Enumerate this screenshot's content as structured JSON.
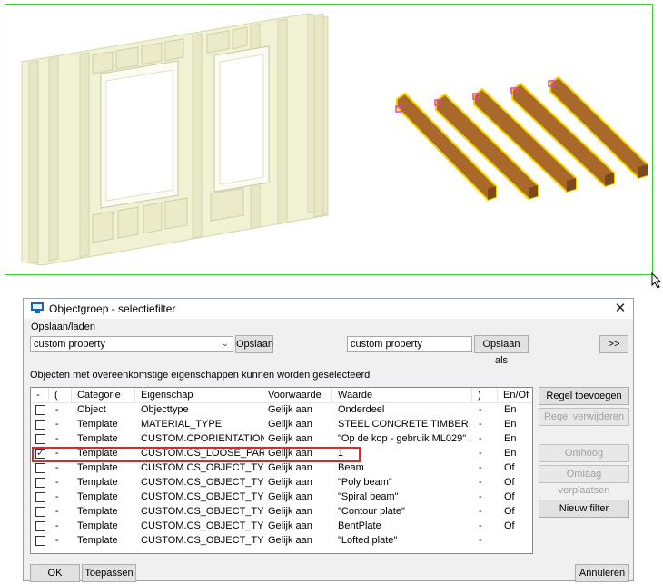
{
  "dialog": {
    "title": "Objectgroep - selectiefilter",
    "close": "✕",
    "load_save_label": "Opslaan/laden",
    "preset_value": "custom property",
    "save_button": "Opslaan",
    "save_as_field": "custom property",
    "save_as_button": "Opslaan als",
    "expand_button": ">>",
    "description": "Objecten met overeenkomstige eigenschappen kunnen worden geselecteerd",
    "columns": [
      "-",
      "(",
      "Categorie",
      "Eigenschap",
      "Voorwaarde",
      "Waarde",
      ")",
      "En/Of"
    ],
    "rows": [
      {
        "checked": false,
        "open": "-",
        "category": "Object",
        "property": "Objecttype",
        "condition": "Gelijk aan",
        "value": "Onderdeel",
        "close": "-",
        "andor": "En"
      },
      {
        "checked": false,
        "open": "-",
        "category": "Template",
        "property": "MATERIAL_TYPE",
        "condition": "Gelijk aan",
        "value": "STEEL CONCRETE TIMBER",
        "close": "-",
        "andor": "En"
      },
      {
        "checked": false,
        "open": "-",
        "category": "Template",
        "property": "CUSTOM.CPORIENTATION",
        "condition": "Gelijk aan",
        "value": "\"Op de kop - gebruik ML029\" ...",
        "close": "-",
        "andor": "En"
      },
      {
        "checked": true,
        "open": "-",
        "category": "Template",
        "property": "CUSTOM.CS_LOOSE_PART",
        "condition": "Gelijk aan",
        "value": "1",
        "close": "-",
        "andor": "En"
      },
      {
        "checked": false,
        "open": "-",
        "category": "Template",
        "property": "CUSTOM.CS_OBJECT_TYPE",
        "condition": "Gelijk aan",
        "value": "Beam",
        "close": "-",
        "andor": "Of"
      },
      {
        "checked": false,
        "open": "-",
        "category": "Template",
        "property": "CUSTOM.CS_OBJECT_TYPE",
        "condition": "Gelijk aan",
        "value": "\"Poly beam\"",
        "close": "-",
        "andor": "Of"
      },
      {
        "checked": false,
        "open": "-",
        "category": "Template",
        "property": "CUSTOM.CS_OBJECT_TYPE",
        "condition": "Gelijk aan",
        "value": "\"Spiral beam\"",
        "close": "-",
        "andor": "Of"
      },
      {
        "checked": false,
        "open": "-",
        "category": "Template",
        "property": "CUSTOM.CS_OBJECT_TYPE",
        "condition": "Gelijk aan",
        "value": "\"Contour plate\"",
        "close": "-",
        "andor": "Of"
      },
      {
        "checked": false,
        "open": "-",
        "category": "Template",
        "property": "CUSTOM.CS_OBJECT_TYPE",
        "condition": "Gelijk aan",
        "value": "BentPlate",
        "close": "-",
        "andor": "Of"
      },
      {
        "checked": false,
        "open": "-",
        "category": "Template",
        "property": "CUSTOM.CS_OBJECT_TYPE",
        "condition": "Gelijk aan",
        "value": "\"Lofted plate\"",
        "close": "-",
        "andor": ""
      }
    ],
    "side_buttons": {
      "add_rule": "Regel toevoegen",
      "delete_rule": "Regel verwijderen",
      "move_up": "Omhoog verplaatsen",
      "move_down": "Omlaag verplaatsen",
      "new_filter": "Nieuw filter"
    },
    "footer": {
      "ok": "OK",
      "apply": "Toepassen",
      "cancel": "Annuleren"
    }
  },
  "colors": {
    "viewport_border": "#39d12f",
    "selection": "#f5d000",
    "beam": "#a8692a",
    "highlight": "#e0262b"
  }
}
